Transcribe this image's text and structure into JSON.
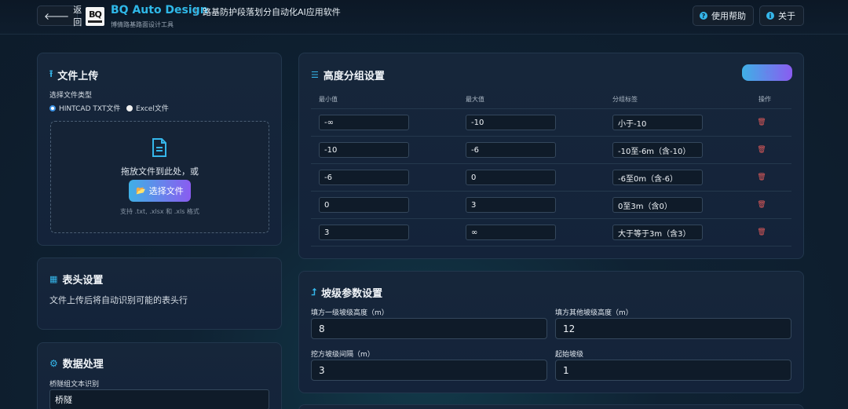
{
  "header": {
    "back_label": "返回",
    "brand": "BQ Auto Design",
    "subtitle": "路基防护段落划分自动化AI应用软件",
    "tagline": "博倩路基路面设计工具",
    "help_label": "使用帮助",
    "about_label": "关于"
  },
  "upload": {
    "title": "文件上传",
    "type_label": "选择文件类型",
    "options": [
      "HINTCAD TXT文件",
      "Excel文件"
    ],
    "selected": "HINTCAD TXT文件",
    "drop_text": "拖放文件到此处，或",
    "choose_label": "选择文件",
    "hint": "支持 .txt, .xlsx 和 .xls 格式"
  },
  "header_settings": {
    "title": "表头设置",
    "description": "文件上传后将自动识别可能的表头行"
  },
  "data_processing": {
    "title": "数据处理",
    "bridge_label": "桥隧组文本识别",
    "bridge_value": "桥隧"
  },
  "height_groups": {
    "title": "高度分组设置",
    "columns": [
      "最小值",
      "最大值",
      "分组标签",
      "操作"
    ],
    "rows": [
      {
        "min": "-∞",
        "max": "-10",
        "label": "小于-10"
      },
      {
        "min": "-10",
        "max": "-6",
        "label": "-10至-6m（含-10）"
      },
      {
        "min": "-6",
        "max": "0",
        "label": "-6至0m（含-6）"
      },
      {
        "min": "0",
        "max": "3",
        "label": "0至3m（含0）"
      },
      {
        "min": "3",
        "max": "∞",
        "label": "大于等于3m（含3）"
      }
    ]
  },
  "slope": {
    "title": "坡级参数设置",
    "fields": [
      {
        "label": "填方一级坡级高度（m）",
        "value": "8"
      },
      {
        "label": "填方其他坡级高度（m）",
        "value": "12"
      },
      {
        "label": "挖方坡级间隔（m）",
        "value": "3"
      },
      {
        "label": "起始坡级",
        "value": "1"
      }
    ]
  },
  "colors": {
    "accent": "#35b6ea",
    "gradient_start": "#3fb0e6",
    "gradient_end": "#8a5cf0",
    "danger": "#e05a5a"
  }
}
